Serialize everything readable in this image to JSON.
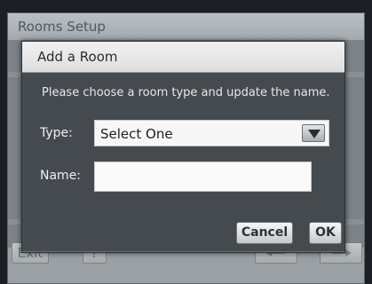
{
  "screen": {
    "title": "Rooms Setup",
    "exit_label": "Exit",
    "help_label": "?"
  },
  "dialog": {
    "title": "Add a Room",
    "message": "Please choose a room type and update the name.",
    "type_label": "Type:",
    "type_value": "Select One",
    "name_label": "Name:",
    "name_value": "",
    "cancel_label": "Cancel",
    "ok_label": "OK"
  },
  "icons": {
    "dropdown": "triangle-down-icon",
    "prev": "arrow-left-icon",
    "next": "arrow-right-icon"
  },
  "colors": {
    "dialog_bg": "#454a4f",
    "header_bg": "#eaeaea",
    "screen_bg": "#7d8387"
  }
}
